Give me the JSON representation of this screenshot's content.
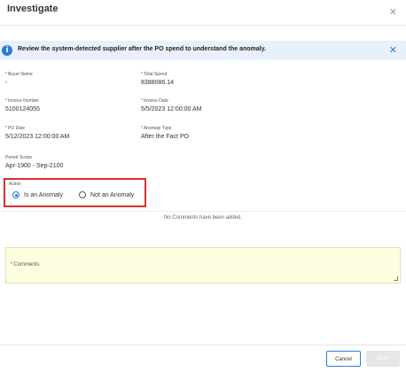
{
  "dialog": {
    "title": "Investigate"
  },
  "banner": {
    "message": "Review the system-detected supplier after the PO spend to understand the anomaly."
  },
  "fields": {
    "buyer_name": {
      "label": "Buyer Name",
      "value": "-"
    },
    "total_spend": {
      "label": "Total Spend",
      "value": "8388086.14"
    },
    "invoice_number": {
      "label": "Invoice Number",
      "value": "5100124055"
    },
    "invoice_date": {
      "label": "Invoice Date",
      "value": "5/5/2023 12:00:00 AM"
    },
    "po_date": {
      "label": "PO Date",
      "value": "5/12/2023 12:00:00 AM"
    },
    "anomaly_type": {
      "label": "Anomaly Type",
      "value": "After the Fact PO"
    },
    "period_scope": {
      "label": "Period Scope",
      "value": "Apr-1900 - Sep-2100"
    }
  },
  "action": {
    "label": "Action",
    "options": [
      {
        "label": "Is an Anomaly",
        "selected": true
      },
      {
        "label": "Not an Anomaly",
        "selected": false
      }
    ]
  },
  "comments": {
    "empty_text": "No Comments have been added.",
    "field_label": "Comments"
  },
  "footer": {
    "cancel_label": "Cancel",
    "save_label": "Save"
  },
  "colors": {
    "accent": "#2f7bd6",
    "banner_bg": "#e8f1fb",
    "highlight_border": "#d9302c",
    "comments_bg": "#fdfde0"
  }
}
